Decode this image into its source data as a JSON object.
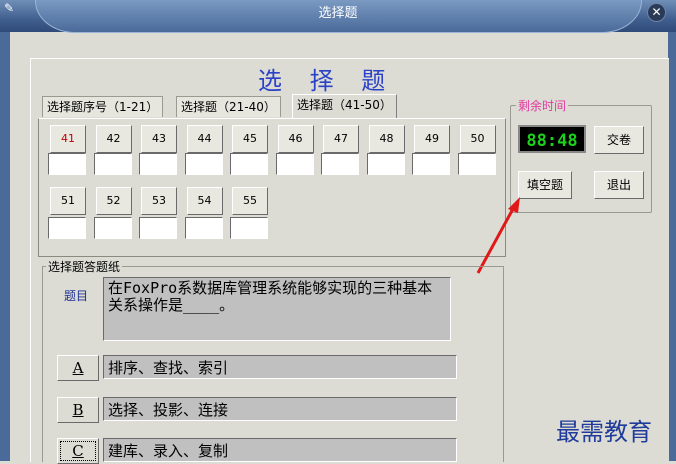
{
  "window": {
    "title": "选择题",
    "close_glyph": "✕"
  },
  "heading": "选 择 题",
  "tabs": [
    {
      "label": "选择题序号（1-21）"
    },
    {
      "label": "选择题（21-40）"
    },
    {
      "label": "选择题（41-50）",
      "active": true
    }
  ],
  "question_buttons_row1": [
    "41",
    "42",
    "43",
    "44",
    "45",
    "46",
    "47",
    "48",
    "49",
    "50"
  ],
  "question_buttons_row2": [
    "51",
    "52",
    "53",
    "54",
    "55"
  ],
  "current_question": "41",
  "remaining": {
    "label": "剩余时间",
    "time": "88:48",
    "submit_label": "交卷",
    "fill_blank_label": "填空题",
    "exit_label": "退出"
  },
  "answer_sheet": {
    "label": "选择题答题纸",
    "question_label": "题目",
    "question_text": "在FoxPro系数据库管理系统能够实现的三种基本关系操作是____。",
    "options": [
      {
        "key": "A",
        "text": "排序、查找、索引"
      },
      {
        "key": "B",
        "text": "选择、投影、连接"
      },
      {
        "key": "C",
        "text": "建库、录入、复制"
      }
    ]
  },
  "watermark": "最需教育",
  "colors": {
    "title_blue": "#2a42c8",
    "timer_green": "#1bd11b",
    "group_pink": "#e23aa0",
    "arrow_red": "#e01818"
  }
}
